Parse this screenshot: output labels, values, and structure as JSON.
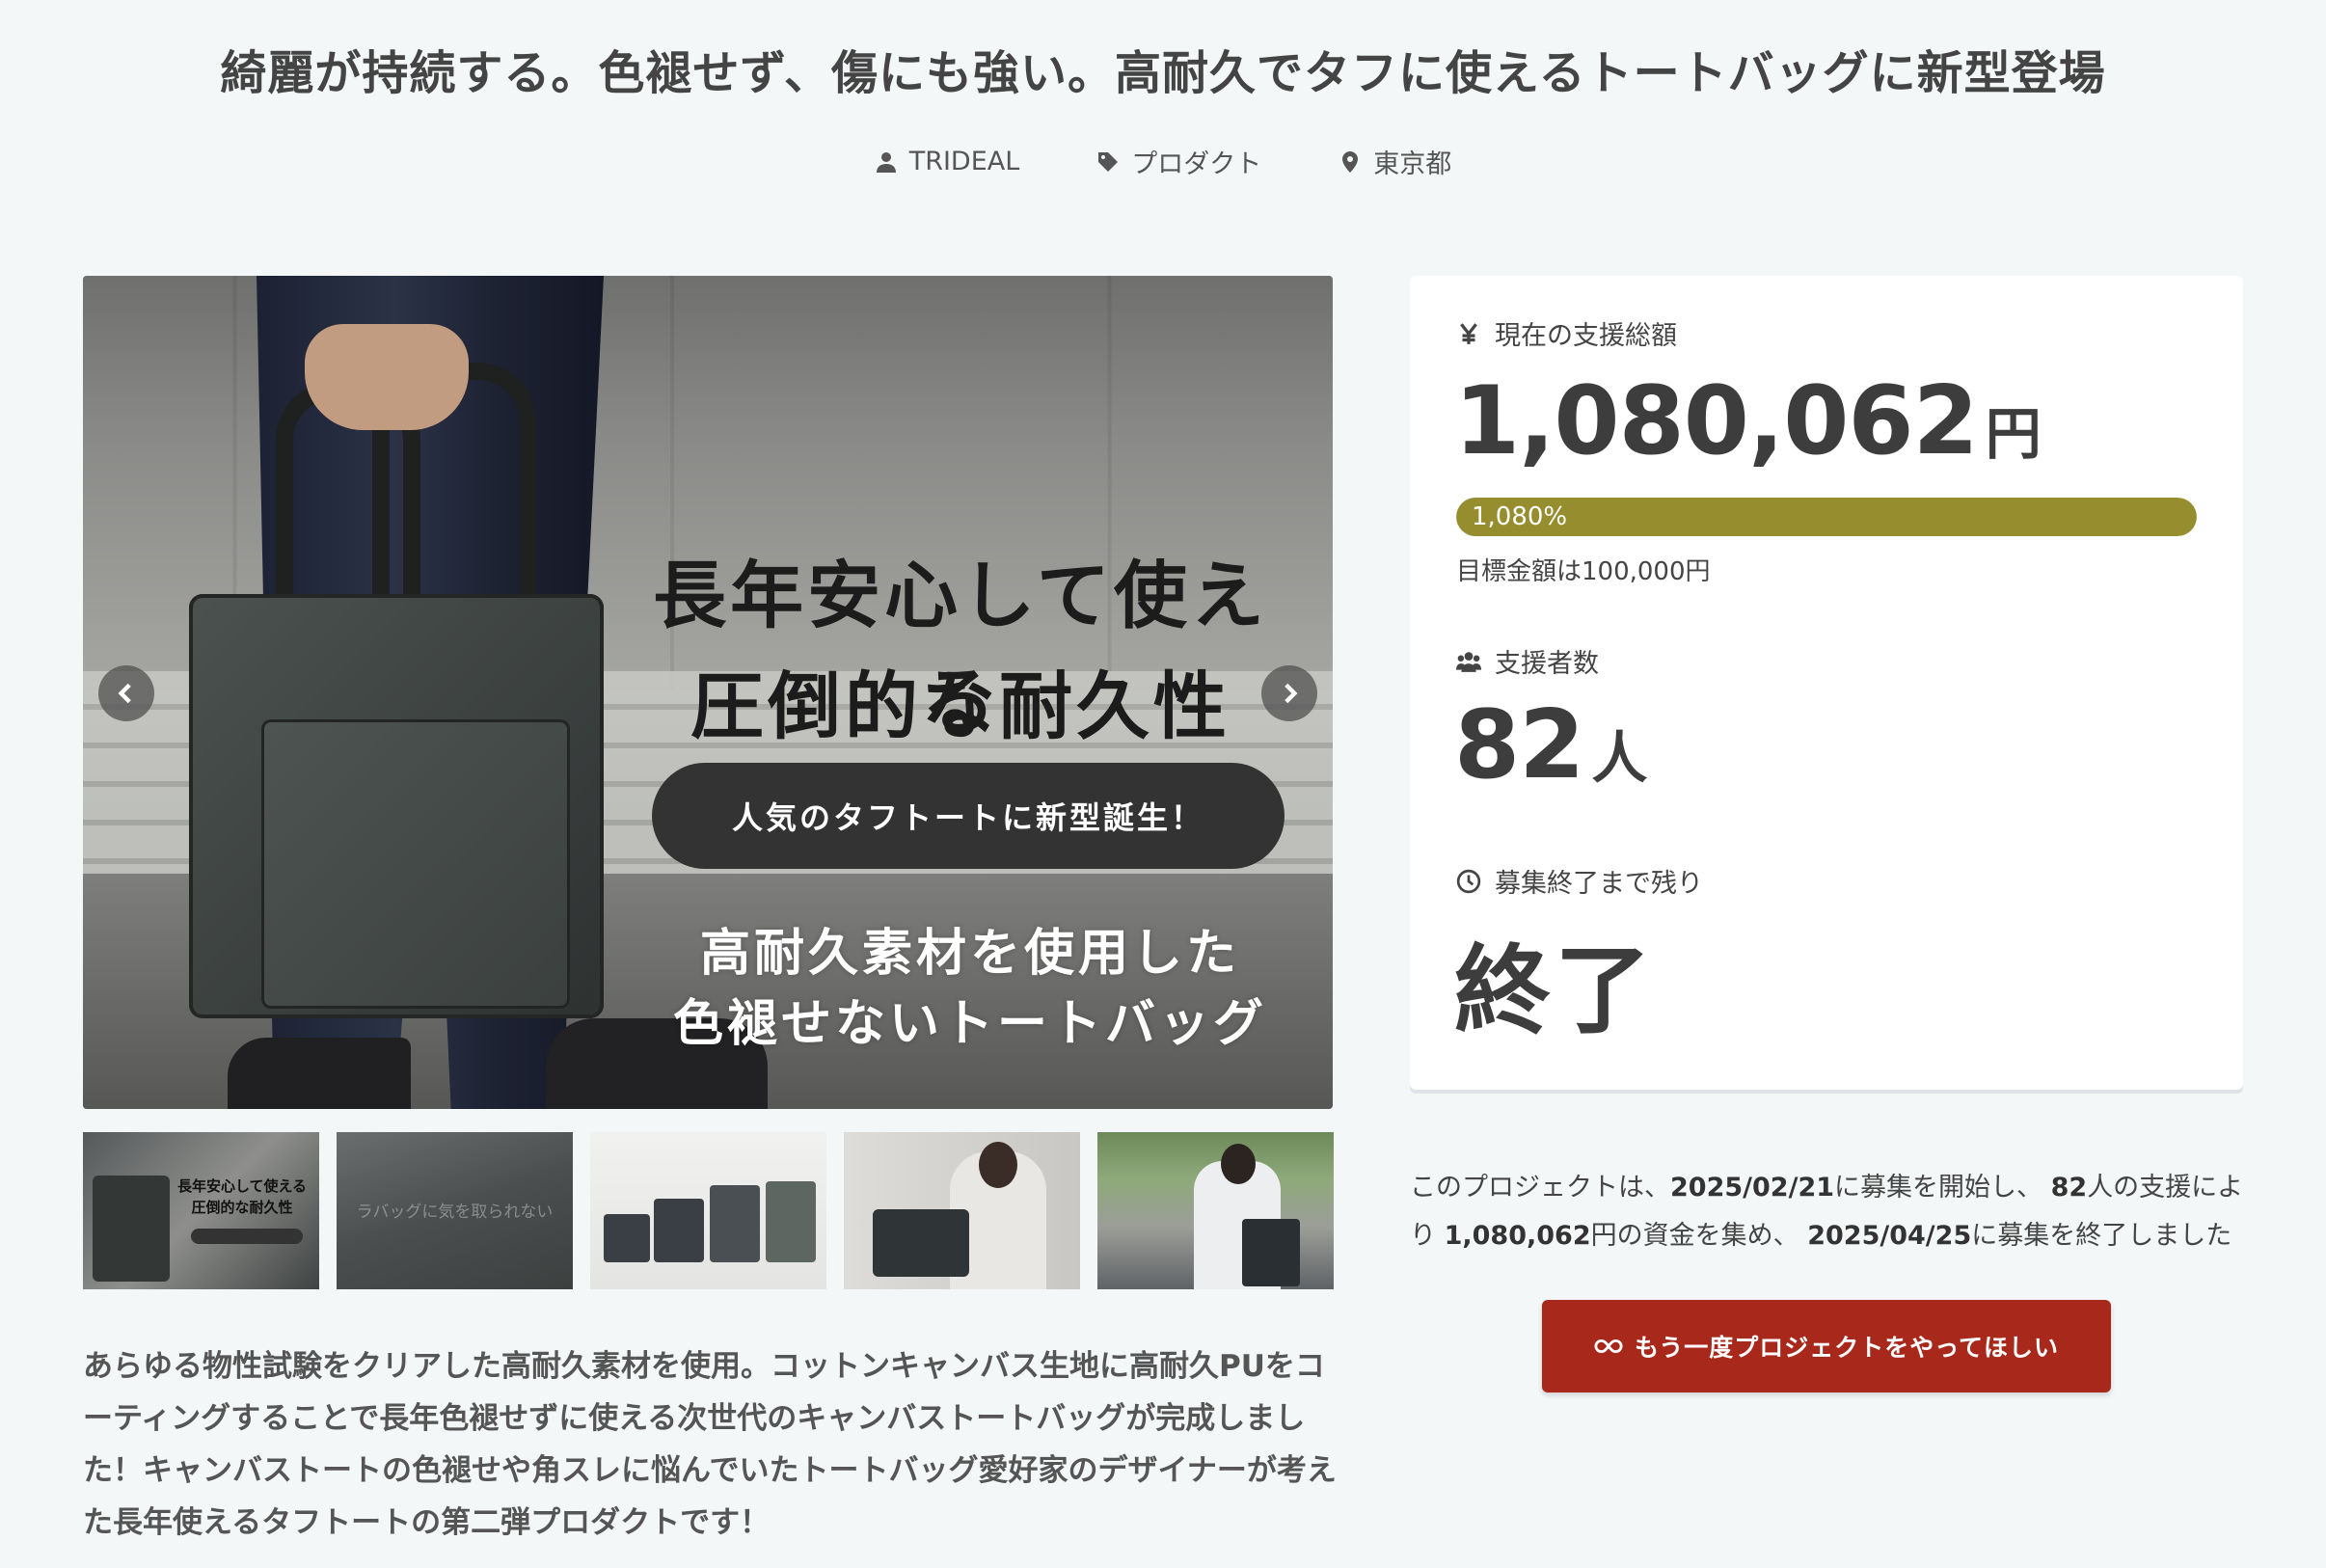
{
  "title": "綺麗が持続する。色褪せず、傷にも強い。高耐久でタフに使えるトートバッグに新型登場",
  "meta": {
    "owner": "TRIDEAL",
    "category": "プロダクト",
    "location": "東京都"
  },
  "hero": {
    "line1": "長年安心して使える",
    "line2": "圧倒的な耐久性",
    "pill": "人気のタフトートに新型誕生！",
    "sub1": "高耐久素材を使用した",
    "sub2": "色褪せないトートバッグ"
  },
  "thumbnails": {
    "t1_line1": "長年安心して使える",
    "t1_line2": "圧倒的な耐久性",
    "t2_text": "ラバッグに気を取られない"
  },
  "description": "あらゆる物性試験をクリアした高耐久素材を使用。コットンキャンバス生地に高耐久PUをコーティングすることで長年色褪せずに使える次世代のキャンバストートバッグが完成しました！キャンバストートの色褪せや角スレに悩んでいたトートバッグ愛好家のデザイナーが考えた長年使えるタフトートの第二弾プロダクトです！",
  "stats": {
    "amount_label": "現在の支援総額",
    "amount": "1,080,062",
    "amount_unit": "円",
    "progress_text": "1,080%",
    "progress_fraction": 1.0,
    "goal_text": "目標金額は100,000円",
    "backers_label": "支援者数",
    "backers": "82",
    "backers_unit": "人",
    "remaining_label": "募集終了まで残り",
    "remaining": "終了"
  },
  "summary": {
    "p1": "このプロジェクトは、",
    "start_date": "2025/02/21",
    "p2": "に募集を開始し、 ",
    "backers": "82",
    "p3": "人の支援により ",
    "amount": "1,080,062",
    "p4": "円の資金を集め、 ",
    "end_date": "2025/04/25",
    "p5": "に募集を終了しました"
  },
  "cta_label": "もう一度プロジェクトをやってほしい",
  "colors": {
    "progress": "#968d2f",
    "cta": "#a8291c"
  }
}
